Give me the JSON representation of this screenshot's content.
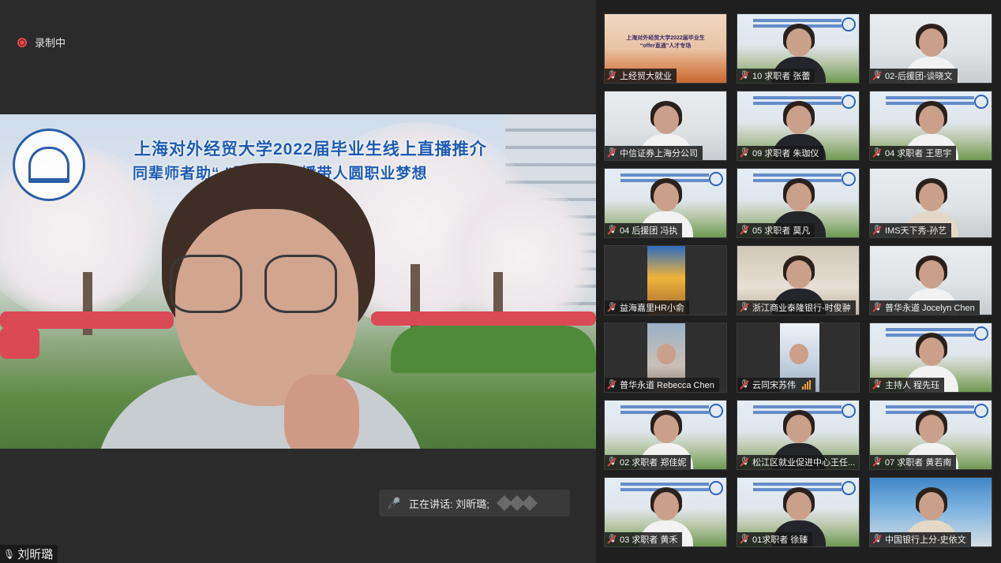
{
  "recording": {
    "label": "录制中",
    "color": "#f04848"
  },
  "main_video": {
    "banner_line1": "上海对外经贸大学2022届毕业生线上直播推介",
    "banner_line2": "同辈师者助“  ”路同行 直播带人圆职业梦想"
  },
  "talking": {
    "label": "正在讲话: 刘昕璐;"
  },
  "self": {
    "name": "刘昕璐"
  },
  "participants": [
    {
      "name": "上经贸大就业",
      "style": "poster",
      "poster_text": "上海对外经贸大学2022届毕业生\n“offer直通”人才专场"
    },
    {
      "name": "10 求职者 张蕾",
      "style": "banner"
    },
    {
      "name": "02-后援团-谈晓文",
      "style": "room"
    },
    {
      "name": "中信证券上海分公司",
      "style": "room"
    },
    {
      "name": "09 求职者 朱珈仪",
      "style": "banner"
    },
    {
      "name": "04 求职者 王思宇",
      "style": "banner"
    },
    {
      "name": "04 后援团 冯执",
      "style": "banner"
    },
    {
      "name": "05 求职者 莫凡",
      "style": "banner"
    },
    {
      "name": "IMS天下秀-孙艺",
      "style": "room"
    },
    {
      "name": "益海嘉里HR小俞",
      "style": "dark-inset-orange"
    },
    {
      "name": "浙江商业泰隆银行-时俊翀",
      "style": "office"
    },
    {
      "name": "普华永道 Jocelyn Chen",
      "style": "room"
    },
    {
      "name": "普华永道 Rebecca Chen",
      "style": "dark-inset-photo"
    },
    {
      "name": "云同宋苏伟",
      "style": "dark-inset-blue"
    },
    {
      "name": "主持人 程先珏",
      "style": "banner"
    },
    {
      "name": "02 求职者 郑佳妮",
      "style": "banner"
    },
    {
      "name": "松江区就业促进中心王任...",
      "style": "banner"
    },
    {
      "name": "07 求职者 黄若南",
      "style": "banner"
    },
    {
      "name": "03 求职者 黄禾",
      "style": "banner"
    },
    {
      "name": "01求职者 徐臻",
      "style": "banner"
    },
    {
      "name": "中国银行上分-史依文",
      "style": "city"
    }
  ]
}
